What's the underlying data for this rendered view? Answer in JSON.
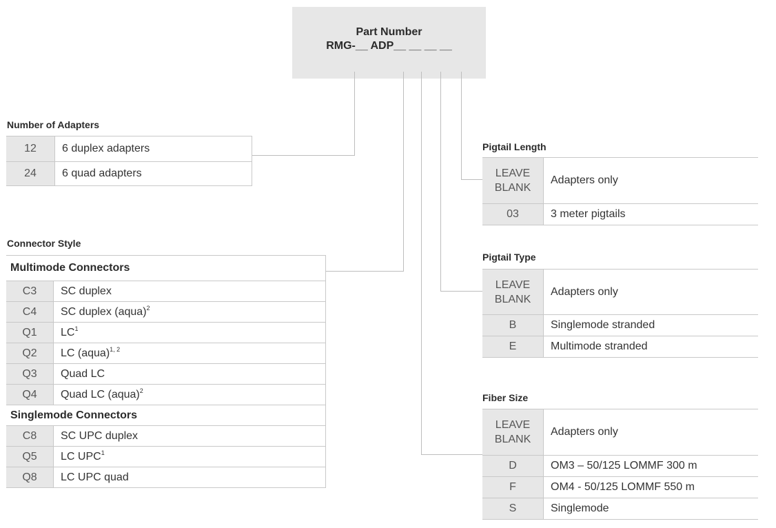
{
  "part_number": {
    "title": "Part Number",
    "code": "RMG-__ ADP__ __ __ __"
  },
  "sections": {
    "adapters": {
      "title": "Number of Adapters",
      "rows": [
        {
          "code": "12",
          "desc": "6 duplex adapters"
        },
        {
          "code": "24",
          "desc": "6 quad adapters"
        }
      ]
    },
    "connector": {
      "title": "Connector Style",
      "multimode_label": "Multimode Connectors",
      "multimode": [
        {
          "code": "C3",
          "desc": "SC duplex",
          "sup": ""
        },
        {
          "code": "C4",
          "desc": "SC duplex (aqua)",
          "sup": "2"
        },
        {
          "code": "Q1",
          "desc": "LC",
          "sup": "1"
        },
        {
          "code": "Q2",
          "desc": "LC (aqua)",
          "sup": "1, 2"
        },
        {
          "code": "Q3",
          "desc": "Quad LC",
          "sup": ""
        },
        {
          "code": "Q4",
          "desc": "Quad LC (aqua)",
          "sup": "2"
        }
      ],
      "singlemode_label": "Singlemode Connectors",
      "singlemode": [
        {
          "code": "C8",
          "desc": "SC UPC duplex",
          "sup": ""
        },
        {
          "code": "Q5",
          "desc": "LC UPC",
          "sup": "1"
        },
        {
          "code": "Q8",
          "desc": "LC UPC quad",
          "sup": ""
        }
      ]
    },
    "pigtail_length": {
      "title": "Pigtail Length",
      "rows": [
        {
          "code": "LEAVE BLANK",
          "desc": "Adapters only"
        },
        {
          "code": "03",
          "desc": "3 meter pigtails"
        }
      ]
    },
    "pigtail_type": {
      "title": "Pigtail Type",
      "rows": [
        {
          "code": "LEAVE BLANK",
          "desc": "Adapters only"
        },
        {
          "code": "B",
          "desc": "Singlemode stranded"
        },
        {
          "code": "E",
          "desc": "Multimode stranded"
        }
      ]
    },
    "fiber_size": {
      "title": "Fiber Size",
      "rows": [
        {
          "code": "LEAVE BLANK",
          "desc": "Adapters only"
        },
        {
          "code": "D",
          "desc": "OM3 – 50/125 LOMMF 300 m"
        },
        {
          "code": "F",
          "desc": "OM4 - 50/125 LOMMF 550 m"
        },
        {
          "code": "S",
          "desc": "Singlemode"
        }
      ]
    }
  }
}
